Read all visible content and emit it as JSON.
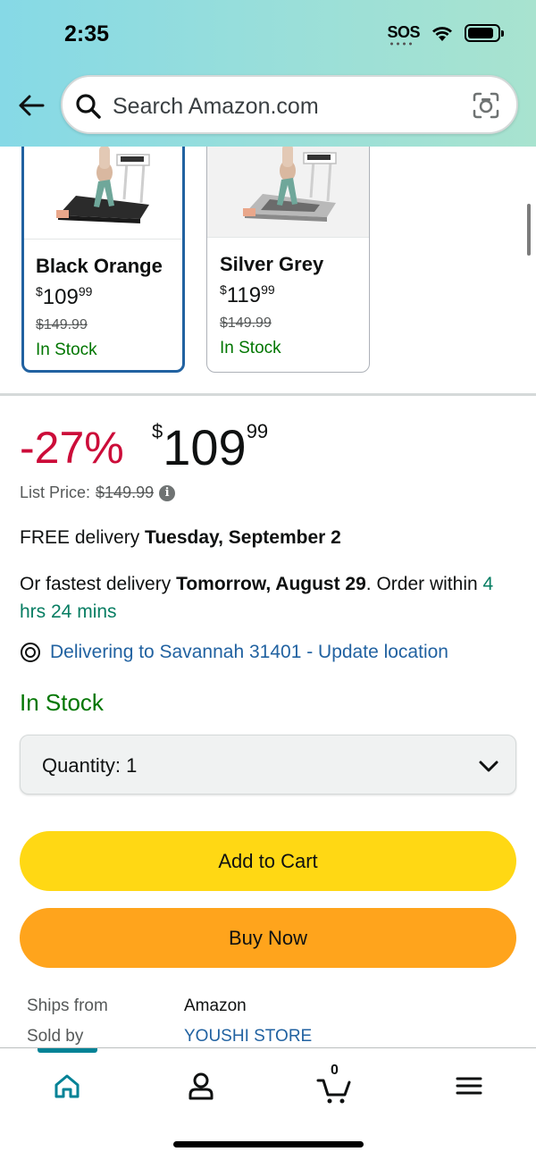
{
  "status_bar": {
    "time": "2:35",
    "sos": "SOS"
  },
  "search": {
    "placeholder": "Search Amazon.com"
  },
  "variants": [
    {
      "name": "Black Orange",
      "price_symbol": "$",
      "price_whole": "109",
      "price_cents": "99",
      "list_price": "$149.99",
      "stock": "In Stock",
      "selected": true
    },
    {
      "name": "Silver Grey",
      "price_symbol": "$",
      "price_whole": "119",
      "price_cents": "99",
      "list_price": "$149.99",
      "stock": "In Stock",
      "selected": false
    }
  ],
  "price": {
    "discount": "-27%",
    "symbol": "$",
    "whole": "109",
    "cents": "99",
    "list_label": "List Price:",
    "list_value": "$149.99"
  },
  "delivery": {
    "free_prefix": "FREE delivery ",
    "free_date": "Tuesday, September 2",
    "fastest_prefix": "Or fastest delivery ",
    "fastest_date": "Tomorrow, August 29",
    "order_within": ". Order within ",
    "countdown": "4 hrs 24 mins",
    "location": "Delivering to Savannah 31401 - Update location"
  },
  "availability": "In Stock",
  "quantity": {
    "label": "Quantity:",
    "value": "1"
  },
  "buttons": {
    "add_to_cart": "Add to Cart",
    "buy_now": "Buy Now"
  },
  "seller": {
    "ships_from_label": "Ships from",
    "ships_from_value": "Amazon",
    "sold_by_label": "Sold by",
    "sold_by_value": "YOUSHI STORE"
  },
  "bottom_nav": {
    "cart_count": "0",
    "icons": [
      "home-icon",
      "account-icon",
      "cart-icon",
      "menu-icon"
    ]
  },
  "colors": {
    "accent_teal": "#008296",
    "discount_red": "#cc0c39",
    "stock_green": "#007600",
    "link_blue": "#2162a1",
    "cart_yellow": "#ffd814",
    "buy_orange": "#ffa41c"
  }
}
